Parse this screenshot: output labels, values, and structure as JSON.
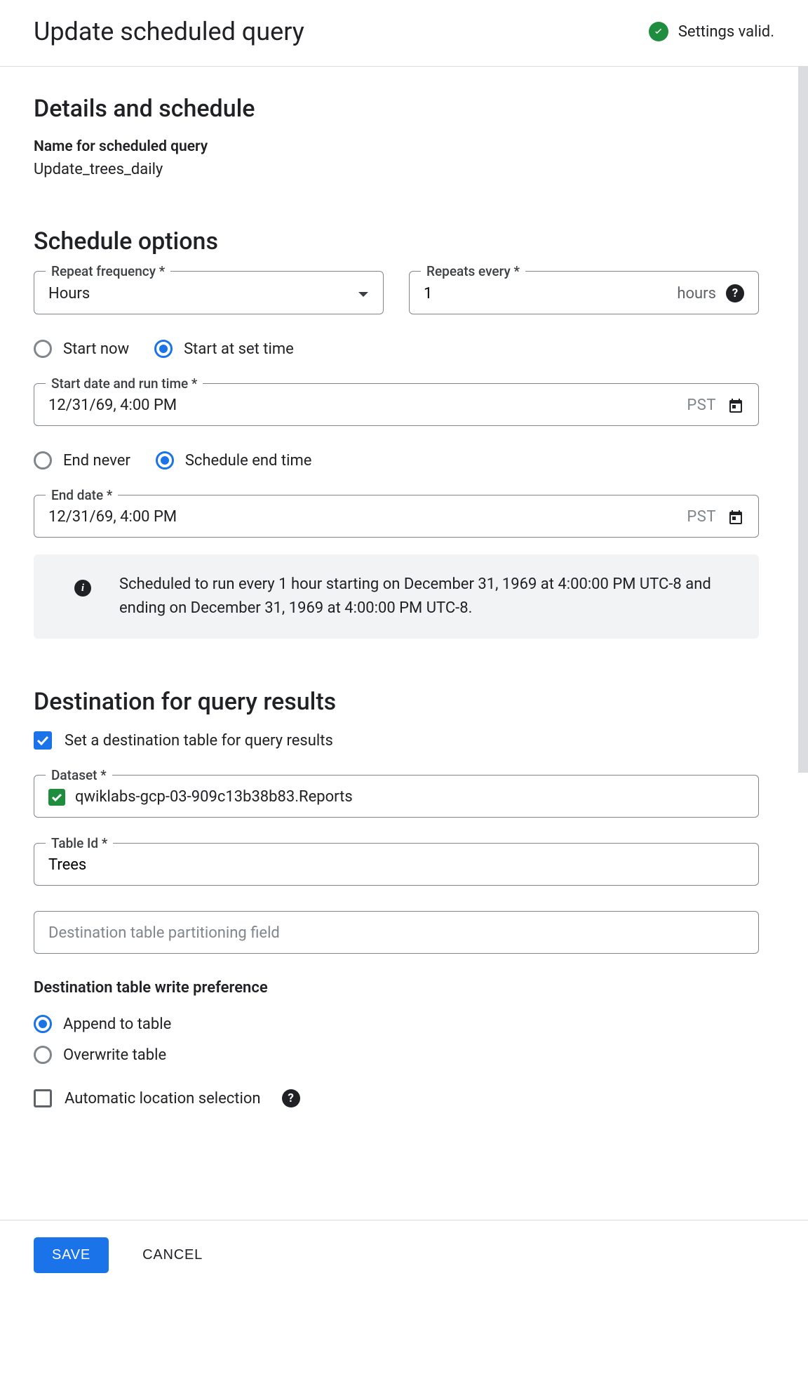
{
  "header": {
    "title": "Update scheduled query",
    "status_text": "Settings valid."
  },
  "details": {
    "heading": "Details and schedule",
    "name_label": "Name for scheduled query",
    "name_value": "Update_trees_daily"
  },
  "schedule": {
    "heading": "Schedule options",
    "repeat_freq_label": "Repeat frequency *",
    "repeat_freq_value": "Hours",
    "repeats_every_label": "Repeats every *",
    "repeats_every_value": "1",
    "repeats_every_unit": "hours",
    "start_now_label": "Start now",
    "start_set_label": "Start at set time",
    "start_datetime_label": "Start date and run time *",
    "start_datetime_value": "12/31/69, 4:00 PM",
    "start_tz": "PST",
    "end_never_label": "End never",
    "end_set_label": "Schedule end time",
    "end_date_label": "End date *",
    "end_date_value": "12/31/69, 4:00 PM",
    "end_tz": "PST",
    "summary": "Scheduled to run every 1 hour starting on December 31, 1969 at 4:00:00 PM UTC-8 and ending on December 31, 1969 at 4:00:00 PM UTC-8."
  },
  "destination": {
    "heading": "Destination for query results",
    "set_dest_label": "Set a destination table for query results",
    "dataset_label": "Dataset *",
    "dataset_value": "qwiklabs-gcp-03-909c13b38b83.Reports",
    "table_id_label": "Table Id *",
    "table_id_value": "Trees",
    "partition_placeholder": "Destination table partitioning field",
    "write_pref_heading": "Destination table write preference",
    "append_label": "Append to table",
    "overwrite_label": "Overwrite table",
    "auto_loc_label": "Automatic location selection"
  },
  "footer": {
    "save": "SAVE",
    "cancel": "CANCEL"
  }
}
